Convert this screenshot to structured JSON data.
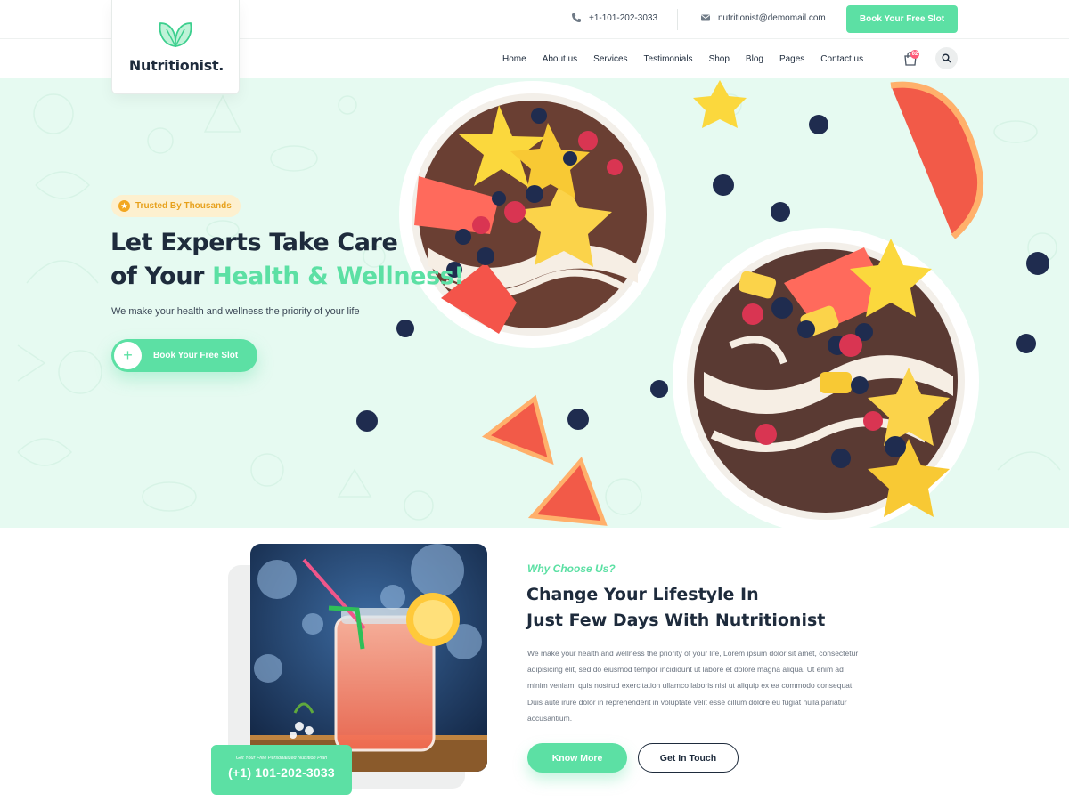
{
  "brand": {
    "name": "Nutritionist.",
    "logo_icon": "leaf-icon",
    "accent": "#5ce0a4",
    "dark": "#1e2b3c"
  },
  "topbar": {
    "phone": "+1-101-202-3033",
    "email": "nutritionist@demomail.com",
    "cta": "Book Your Free Slot"
  },
  "nav": {
    "items": [
      "Home",
      "About us",
      "Services",
      "Testimonials",
      "Shop",
      "Blog",
      "Pages",
      "Contact us"
    ],
    "cart_count": "02",
    "cart_icon": "shopping-bag-icon",
    "search_icon": "search-icon"
  },
  "hero": {
    "badge": "Trusted By Thousands",
    "title_line1": "Let Experts Take Care",
    "title_line2_prefix": "of Your ",
    "title_highlight": "Health & Wellness!",
    "subtitle": "We make your health and wellness the priority of your life",
    "cta": "Book Your Free Slot"
  },
  "why": {
    "eyebrow": "Why Choose Us?",
    "title_line1": "Change Your Lifestyle In",
    "title_line2": "Just Few Days With Nutritionist",
    "body": "We make your health and wellness the priority of your life, Lorem ipsum dolor sit amet, consectetur adipisicing elit, sed do eiusmod tempor incididunt ut labore et dolore magna aliqua. Ut enim ad minim veniam, quis nostrud exercitation ullamco laboris nisi ut aliquip ex ea commodo consequat. Duis aute irure dolor in reprehenderit in voluptate velit esse cillum dolore eu fugiat nulla pariatur accusantium.",
    "btn_primary": "Know More",
    "btn_secondary": "Get In Touch",
    "promo_small": "Get Your Free Personalized Nutrition Plan",
    "promo_phone": "(+1) 101-202-3033"
  }
}
